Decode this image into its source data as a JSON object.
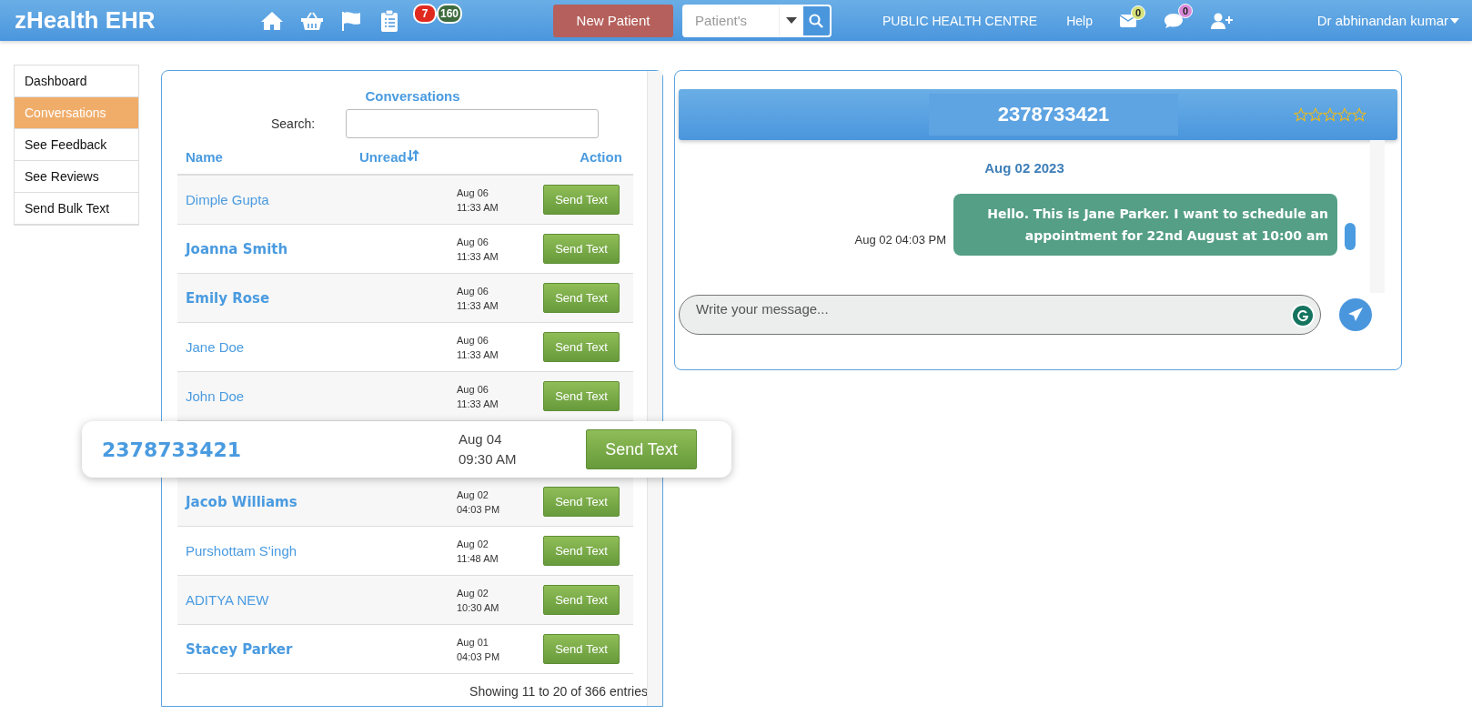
{
  "header": {
    "brand": "zHealth EHR",
    "badges": [
      {
        "count": "7",
        "color": "#e02a1f"
      },
      {
        "count": "160",
        "color": "#3d6b3d"
      }
    ],
    "new_patient": "New Patient",
    "search": {
      "placeholder": "Patient's"
    },
    "centre": "PUBLIC HEALTH CENTRE",
    "help": "Help",
    "mail_count": "0",
    "chat_count": "0",
    "user": "Dr abhinandan kumar"
  },
  "sidebar": {
    "items": [
      {
        "label": "Dashboard",
        "selected": false
      },
      {
        "label": "Conversations",
        "selected": true
      },
      {
        "label": "See Feedback",
        "selected": false
      },
      {
        "label": "See Reviews",
        "selected": false
      },
      {
        "label": "Send Bulk Text",
        "selected": false
      }
    ]
  },
  "conversations": {
    "title": "Conversations",
    "search_label": "Search:",
    "columns": [
      "Name",
      "Unread",
      "Action"
    ],
    "rows": [
      {
        "name": "Dimple Gupta",
        "date": "Aug 06",
        "time": "11:33 AM",
        "action": "Send Text",
        "bold": false,
        "highlighted": false
      },
      {
        "name": "Joanna Smith",
        "date": "Aug 06",
        "time": "11:33 AM",
        "action": "Send Text",
        "bold": true,
        "highlighted": false
      },
      {
        "name": "Emily Rose",
        "date": "Aug 06",
        "time": "11:33 AM",
        "action": "Send Text",
        "bold": true,
        "highlighted": false
      },
      {
        "name": "Jane Doe",
        "date": "Aug 06",
        "time": "11:33 AM",
        "action": "Send Text",
        "bold": false,
        "highlighted": false
      },
      {
        "name": "John Doe",
        "date": "Aug 06",
        "time": "11:33 AM",
        "action": "Send Text",
        "bold": false,
        "highlighted": false
      },
      {
        "name": "2378733421",
        "date": "Aug 04",
        "time": "09:30 AM",
        "action": "Send Text",
        "bold": true,
        "highlighted": true
      },
      {
        "name": "Jacob Williams",
        "date": "Aug 02",
        "time": "04:03 PM",
        "action": "Send Text",
        "bold": true,
        "highlighted": false
      },
      {
        "name": "Purshottam S'ingh",
        "date": "Aug 02",
        "time": "11:48 AM",
        "action": "Send Text",
        "bold": false,
        "highlighted": false
      },
      {
        "name": "ADITYA NEW",
        "date": "Aug 02",
        "time": "10:30 AM",
        "action": "Send Text",
        "bold": false,
        "highlighted": false
      },
      {
        "name": "Stacey Parker",
        "date": "Aug 01",
        "time": "04:03 PM",
        "action": "Send Text",
        "bold": true,
        "highlighted": false
      }
    ],
    "footer": "Showing 11 to 20 of 366 entries"
  },
  "chat": {
    "title": "2378733421",
    "stars": 0,
    "date": "Aug 02 2023",
    "messages": [
      {
        "time": "Aug 02 04:03 PM",
        "text": "Hello. This is Jane Parker. I want to schedule an appointment for 22nd August at 10:00 am"
      }
    ],
    "input": {
      "placeholder": "Write your message..."
    }
  }
}
